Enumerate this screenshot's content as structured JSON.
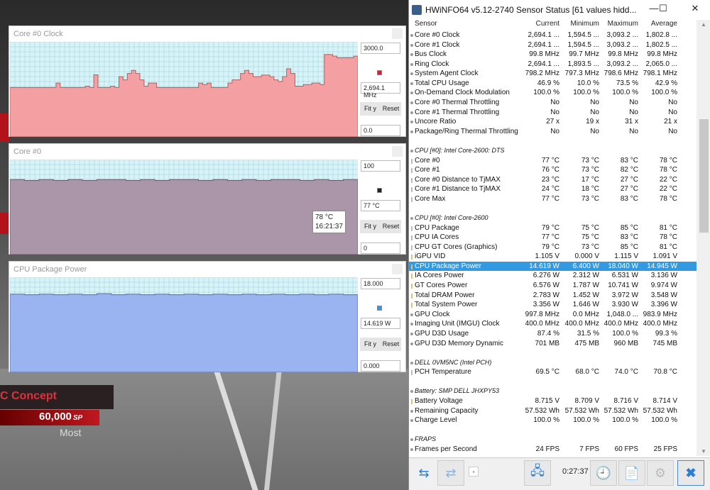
{
  "background_game": {
    "car_name": "C Concept",
    "points": "60,000",
    "points_unit": "SP",
    "label": "Most"
  },
  "graphs": [
    {
      "title": "Core #0 Clock",
      "max": "3000.0",
      "current": "2,694.1 MHz",
      "min": "0.0",
      "fit_label": "Fit y",
      "reset_label": "Reset",
      "color": "#f4a0a3",
      "line": "#b06060",
      "swatch": "#d0203a",
      "range": [
        0,
        3000
      ],
      "values": [
        1560,
        1560,
        1560,
        1560,
        1560,
        1560,
        1560,
        1560,
        1560,
        1560,
        1560,
        1700,
        1560,
        1560,
        1560,
        1560,
        1560,
        1560,
        1600,
        1560,
        1960,
        1560,
        1560,
        1560,
        1600,
        1560,
        1900,
        1800,
        2000,
        2100,
        2000,
        1800,
        1600,
        1700,
        1700,
        1560,
        1560,
        1560,
        1560,
        1560,
        1560,
        1560,
        1560,
        1560,
        1560,
        1700,
        1650,
        1700,
        1560,
        1560,
        1560,
        1560,
        1700,
        1800,
        1800,
        2000,
        2100,
        2000,
        1900,
        1900,
        1950,
        1950,
        1900,
        1800,
        1750,
        1900,
        2150,
        2000,
        1600,
        1600,
        1650,
        1650,
        1700,
        1700,
        1650,
        2600,
        2600,
        2550,
        2500,
        2500,
        2500,
        2500,
        2550
      ]
    },
    {
      "title": "Core #0",
      "max": "100",
      "current": "77 °C",
      "min": "0",
      "fit_label": "Fit y",
      "reset_label": "Reset",
      "color": "#aa96a8",
      "line": "#6a5a6a",
      "swatch": "#222222",
      "range": [
        0,
        100
      ],
      "values": [
        79,
        78,
        79,
        78,
        79,
        78,
        79,
        79,
        78,
        79,
        78,
        79,
        79,
        78,
        79,
        78,
        79,
        78,
        79,
        79,
        78,
        79,
        78,
        79
      ],
      "tooltip": {
        "value": "78 °C",
        "time": "16:21:37"
      }
    },
    {
      "title": "CPU Package Power",
      "max": "18.000",
      "current": "14.619 W",
      "min": "0.000",
      "fit_label": "Fit y",
      "reset_label": "Reset",
      "color": "#99b4f0",
      "line": "#5a6a9a",
      "swatch": "#4a90d0",
      "range": [
        0,
        18
      ],
      "values": [
        14.8,
        14.7,
        14.8,
        14.7,
        14.8,
        14.7,
        14.9,
        14.7,
        14.8,
        14.7,
        14.8,
        14.7,
        14.8,
        14.7,
        14.8,
        14.7,
        14.8,
        14.7,
        14.8,
        14.7,
        14.8,
        14.7,
        14.8,
        14.7
      ]
    }
  ],
  "window": {
    "title": "HWiNFO64 v5.12-2740 Sensor Status [61 values hidd...",
    "minimize": "—",
    "maximize": "☐",
    "close": "✕",
    "columns": [
      "Sensor",
      "Current",
      "Minimum",
      "Maximum",
      "Average"
    ],
    "rows": [
      {
        "type": "s",
        "icon": "clock",
        "cells": [
          "Core #0 Clock",
          "2,694.1 ...",
          "1,594.5 ...",
          "3,093.2 ...",
          "1,802.8 ..."
        ]
      },
      {
        "type": "s",
        "icon": "clock",
        "cells": [
          "Core #1 Clock",
          "2,694.1 ...",
          "1,594.5 ...",
          "3,093.2 ...",
          "1,802.5 ..."
        ]
      },
      {
        "type": "s",
        "icon": "clock",
        "cells": [
          "Bus Clock",
          "99.8 MHz",
          "99.7 MHz",
          "99.8 MHz",
          "99.8 MHz"
        ]
      },
      {
        "type": "s",
        "icon": "clock",
        "cells": [
          "Ring Clock",
          "2,694.1 ...",
          "1,893.5 ...",
          "3,093.2 ...",
          "2,065.0 ..."
        ]
      },
      {
        "type": "s",
        "icon": "clock",
        "cells": [
          "System Agent Clock",
          "798.2 MHz",
          "797.3 MHz",
          "798.6 MHz",
          "798.1 MHz"
        ]
      },
      {
        "type": "s",
        "icon": "usage",
        "cells": [
          "Total CPU Usage",
          "46.9 %",
          "10.0 %",
          "73.5 %",
          "42.9 %"
        ]
      },
      {
        "type": "s",
        "icon": "usage",
        "cells": [
          "On-Demand Clock Modulation",
          "100.0 %",
          "100.0 %",
          "100.0 %",
          "100.0 %"
        ]
      },
      {
        "type": "s",
        "icon": "flag",
        "cells": [
          "Core #0 Thermal Throttling",
          "No",
          "No",
          "No",
          "No"
        ]
      },
      {
        "type": "s",
        "icon": "flag",
        "cells": [
          "Core #1 Thermal Throttling",
          "No",
          "No",
          "No",
          "No"
        ]
      },
      {
        "type": "s",
        "icon": "ratio",
        "cells": [
          "Uncore Ratio",
          "27 x",
          "19 x",
          "31 x",
          "21 x"
        ]
      },
      {
        "type": "s",
        "icon": "flag",
        "cells": [
          "Package/Ring Thermal Throttling",
          "No",
          "No",
          "No",
          "No"
        ]
      },
      {
        "type": "blank"
      },
      {
        "type": "hdr",
        "cells": [
          "CPU [#0]: Intel Core-2600: DTS"
        ]
      },
      {
        "type": "s",
        "icon": "temp",
        "cells": [
          "Core #0",
          "77 °C",
          "73 °C",
          "83 °C",
          "78 °C"
        ]
      },
      {
        "type": "s",
        "icon": "temp",
        "cells": [
          "Core #1",
          "76 °C",
          "73 °C",
          "82 °C",
          "78 °C"
        ]
      },
      {
        "type": "s",
        "icon": "temp",
        "cells": [
          "Core #0 Distance to TjMAX",
          "23 °C",
          "17 °C",
          "27 °C",
          "22 °C"
        ]
      },
      {
        "type": "s",
        "icon": "temp",
        "cells": [
          "Core #1 Distance to TjMAX",
          "24 °C",
          "18 °C",
          "27 °C",
          "22 °C"
        ]
      },
      {
        "type": "s",
        "icon": "temp",
        "cells": [
          "Core Max",
          "77 °C",
          "73 °C",
          "83 °C",
          "78 °C"
        ]
      },
      {
        "type": "blank"
      },
      {
        "type": "hdr",
        "cells": [
          "CPU [#0]: Intel Core-2600"
        ]
      },
      {
        "type": "s",
        "icon": "temp",
        "cells": [
          "CPU Package",
          "79 °C",
          "75 °C",
          "85 °C",
          "81 °C"
        ]
      },
      {
        "type": "s",
        "icon": "temp",
        "cells": [
          "CPU IA Cores",
          "77 °C",
          "75 °C",
          "83 °C",
          "78 °C"
        ]
      },
      {
        "type": "s",
        "icon": "temp",
        "cells": [
          "CPU GT Cores (Graphics)",
          "79 °C",
          "73 °C",
          "85 °C",
          "81 °C"
        ]
      },
      {
        "type": "s",
        "icon": "volt",
        "cells": [
          "iGPU VID",
          "1.105 V",
          "0.000 V",
          "1.115 V",
          "1.091 V"
        ]
      },
      {
        "type": "s",
        "icon": "volt",
        "selected": true,
        "cells": [
          "CPU Package Power",
          "14.619 W",
          "6.400 W",
          "18.040 W",
          "14.945 W"
        ]
      },
      {
        "type": "s",
        "icon": "volt",
        "cells": [
          "IA Cores Power",
          "6.276 W",
          "2.312 W",
          "6.531 W",
          "3.136 W"
        ]
      },
      {
        "type": "s",
        "icon": "volt",
        "cells": [
          "GT Cores Power",
          "6.576 W",
          "1.787 W",
          "10.741 W",
          "9.974 W"
        ]
      },
      {
        "type": "s",
        "icon": "volt",
        "cells": [
          "Total DRAM Power",
          "2.783 W",
          "1.452 W",
          "3.972 W",
          "3.548 W"
        ]
      },
      {
        "type": "s",
        "icon": "volt",
        "cells": [
          "Total System Power",
          "3.356 W",
          "1.646 W",
          "3.930 W",
          "3.396 W"
        ]
      },
      {
        "type": "s",
        "icon": "clock",
        "cells": [
          "GPU Clock",
          "997.8 MHz",
          "0.0 MHz",
          "1,048.0 ...",
          "983.9 MHz"
        ]
      },
      {
        "type": "s",
        "icon": "clock",
        "cells": [
          "Imaging Unit (IMGU) Clock",
          "400.0 MHz",
          "400.0 MHz",
          "400.0 MHz",
          "400.0 MHz"
        ]
      },
      {
        "type": "s",
        "icon": "usage",
        "cells": [
          "GPU D3D Usage",
          "87.4 %",
          "31.5 %",
          "100.0 %",
          "99.3 %"
        ]
      },
      {
        "type": "s",
        "icon": "usage",
        "cells": [
          "GPU D3D Memory Dynamic",
          "701 MB",
          "475 MB",
          "960 MB",
          "745 MB"
        ]
      },
      {
        "type": "blank"
      },
      {
        "type": "hdr",
        "cells": [
          "DELL 0VM5NC (Intel PCH)"
        ]
      },
      {
        "type": "s",
        "icon": "temp",
        "cells": [
          "PCH Temperature",
          "69.5 °C",
          "68.0 °C",
          "74.0 °C",
          "70.8 °C"
        ]
      },
      {
        "type": "blank"
      },
      {
        "type": "hdr",
        "cells": [
          "Battery: SMP DELL JHXPY53"
        ]
      },
      {
        "type": "s",
        "icon": "volt",
        "cells": [
          "Battery Voltage",
          "8.715 V",
          "8.709 V",
          "8.716 V",
          "8.714 V"
        ]
      },
      {
        "type": "s",
        "icon": "usage",
        "cells": [
          "Remaining Capacity",
          "57.532 Wh",
          "57.532 Wh",
          "57.532 Wh",
          "57.532 Wh"
        ]
      },
      {
        "type": "s",
        "icon": "usage",
        "cells": [
          "Charge Level",
          "100.0 %",
          "100.0 %",
          "100.0 %",
          "100.0 %"
        ]
      },
      {
        "type": "blank"
      },
      {
        "type": "hdr",
        "cells": [
          "FRAPS"
        ]
      },
      {
        "type": "s",
        "icon": "usage",
        "cells": [
          "Frames per Second",
          "24 FPS",
          "7 FPS",
          "60 FPS",
          "25 FPS"
        ]
      }
    ],
    "toolbar": {
      "elapsed": "0:27:37"
    }
  }
}
